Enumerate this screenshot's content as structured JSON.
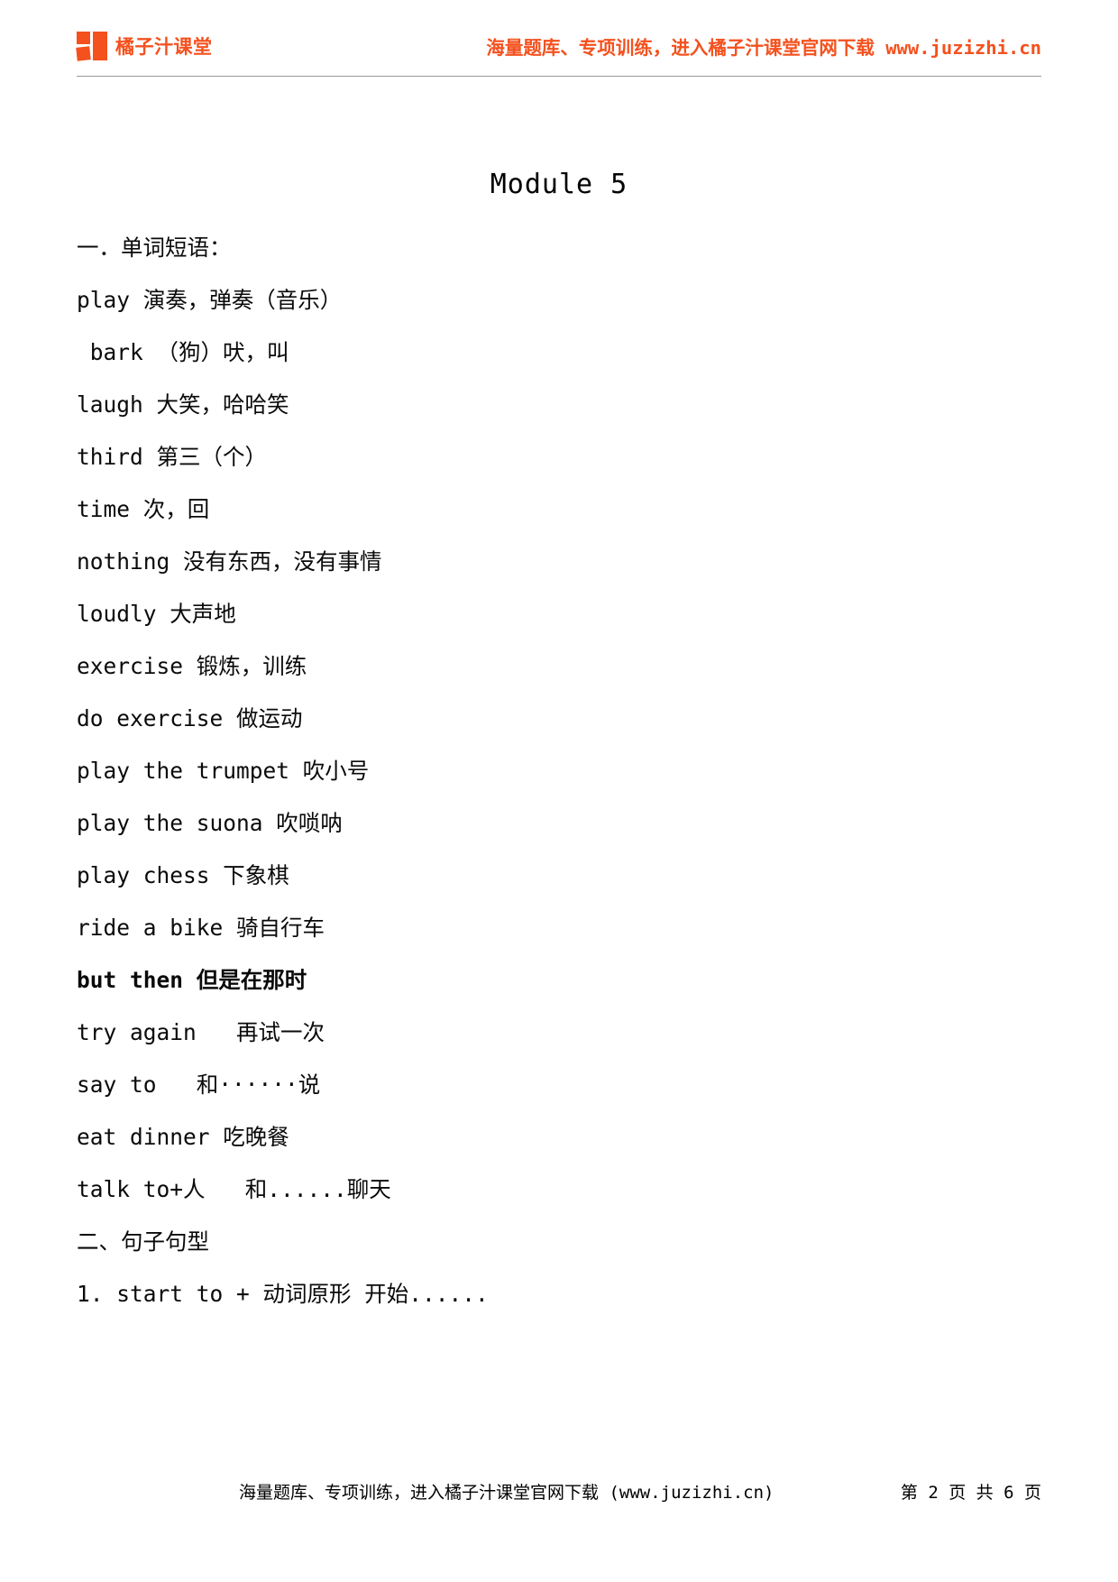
{
  "header": {
    "logo_icon": "four-square-grid-logo-icon",
    "brand_name": "橘子汁课堂",
    "tagline": "海量题库、专项训练，进入橘子汁课堂官网下载 www.juzizhi.cn",
    "accent_color": "#f4511e"
  },
  "document": {
    "title": "Module 5",
    "sections": [
      {
        "heading": "一．单词短语："
      }
    ],
    "lines": [
      "一．单词短语：",
      "play 演奏，弹奏（音乐）",
      " bark （狗）吠，叫",
      "laugh 大笑，哈哈笑",
      "third 第三（个）",
      "time 次，回",
      "nothing 没有东西，没有事情",
      "loudly 大声地",
      "exercise 锻炼，训练",
      "do exercise 做运动",
      "play the trumpet 吹小号",
      "play the suona 吹唢呐",
      "play chess 下象棋",
      "ride a bike 骑自行车",
      "but then 但是在那时",
      "try again   再试一次",
      "say to   和······说",
      "eat dinner 吃晚餐",
      "talk to+人   和......聊天",
      "二、句子句型",
      "1. start to + 动词原形 开始......"
    ]
  },
  "footer": {
    "note": "海量题库、专项训练，进入橘子汁课堂官网下载 (www.juzizhi.cn)",
    "page_label": "第 2 页 共 6 页"
  }
}
